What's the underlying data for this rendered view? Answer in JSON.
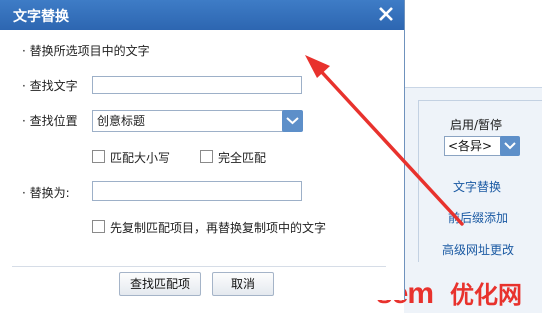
{
  "dialog": {
    "title": "文字替换",
    "section_heading": "替换所选项目中的文字",
    "find_label": "查找文字",
    "find_value": "",
    "position_label": "查找位置",
    "position_value": "创意标题",
    "match_case_label": "匹配大小写",
    "match_case_checked": false,
    "whole_match_label": "完全匹配",
    "whole_match_checked": false,
    "replace_label": "替换为:",
    "replace_value": "",
    "copy_first_label": "先复制匹配项目，再替换复制项中的文字",
    "copy_first_checked": false,
    "find_button": "查找匹配项",
    "cancel_button": "取消"
  },
  "side_panel": {
    "pause_label": "启用/暂停",
    "status_select": "<各异>",
    "links": [
      "文字替换",
      "前后缀添加",
      "高级网址更改"
    ]
  },
  "watermark": {
    "latin": "sem",
    "chinese": "优化网"
  },
  "colors": {
    "title_bar": "#3a76c1",
    "accent_button": "#5d8fc9",
    "link": "#1b5aa3",
    "arrow": "#e8322d"
  }
}
